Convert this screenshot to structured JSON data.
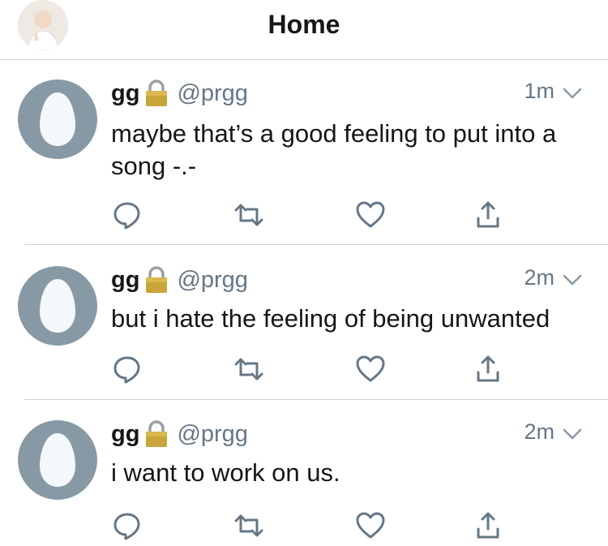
{
  "header": {
    "title": "Home",
    "avatar_icon": "profile-photo"
  },
  "tweets": [
    {
      "name": "gg",
      "handle": "@prgg",
      "time": "1m",
      "text": "maybe that’s a good feeling to put into a song -.-",
      "protected_icon": "lock-icon"
    },
    {
      "name": "gg",
      "handle": "@prgg",
      "time": "2m",
      "text": "but i hate the feeling of being unwanted",
      "protected_icon": "lock-icon"
    },
    {
      "name": "gg",
      "handle": "@prgg",
      "time": "2m",
      "text": "i want to work on us.",
      "protected_icon": "lock-icon"
    }
  ],
  "actions": {
    "icons": [
      "reply-icon",
      "retweet-icon",
      "like-icon",
      "share-icon"
    ]
  },
  "colors": {
    "text": "#14171a",
    "secondary": "#657786",
    "icon": "#657786",
    "egg_bg": "#8899a6",
    "divider": "#cfd4d8"
  }
}
